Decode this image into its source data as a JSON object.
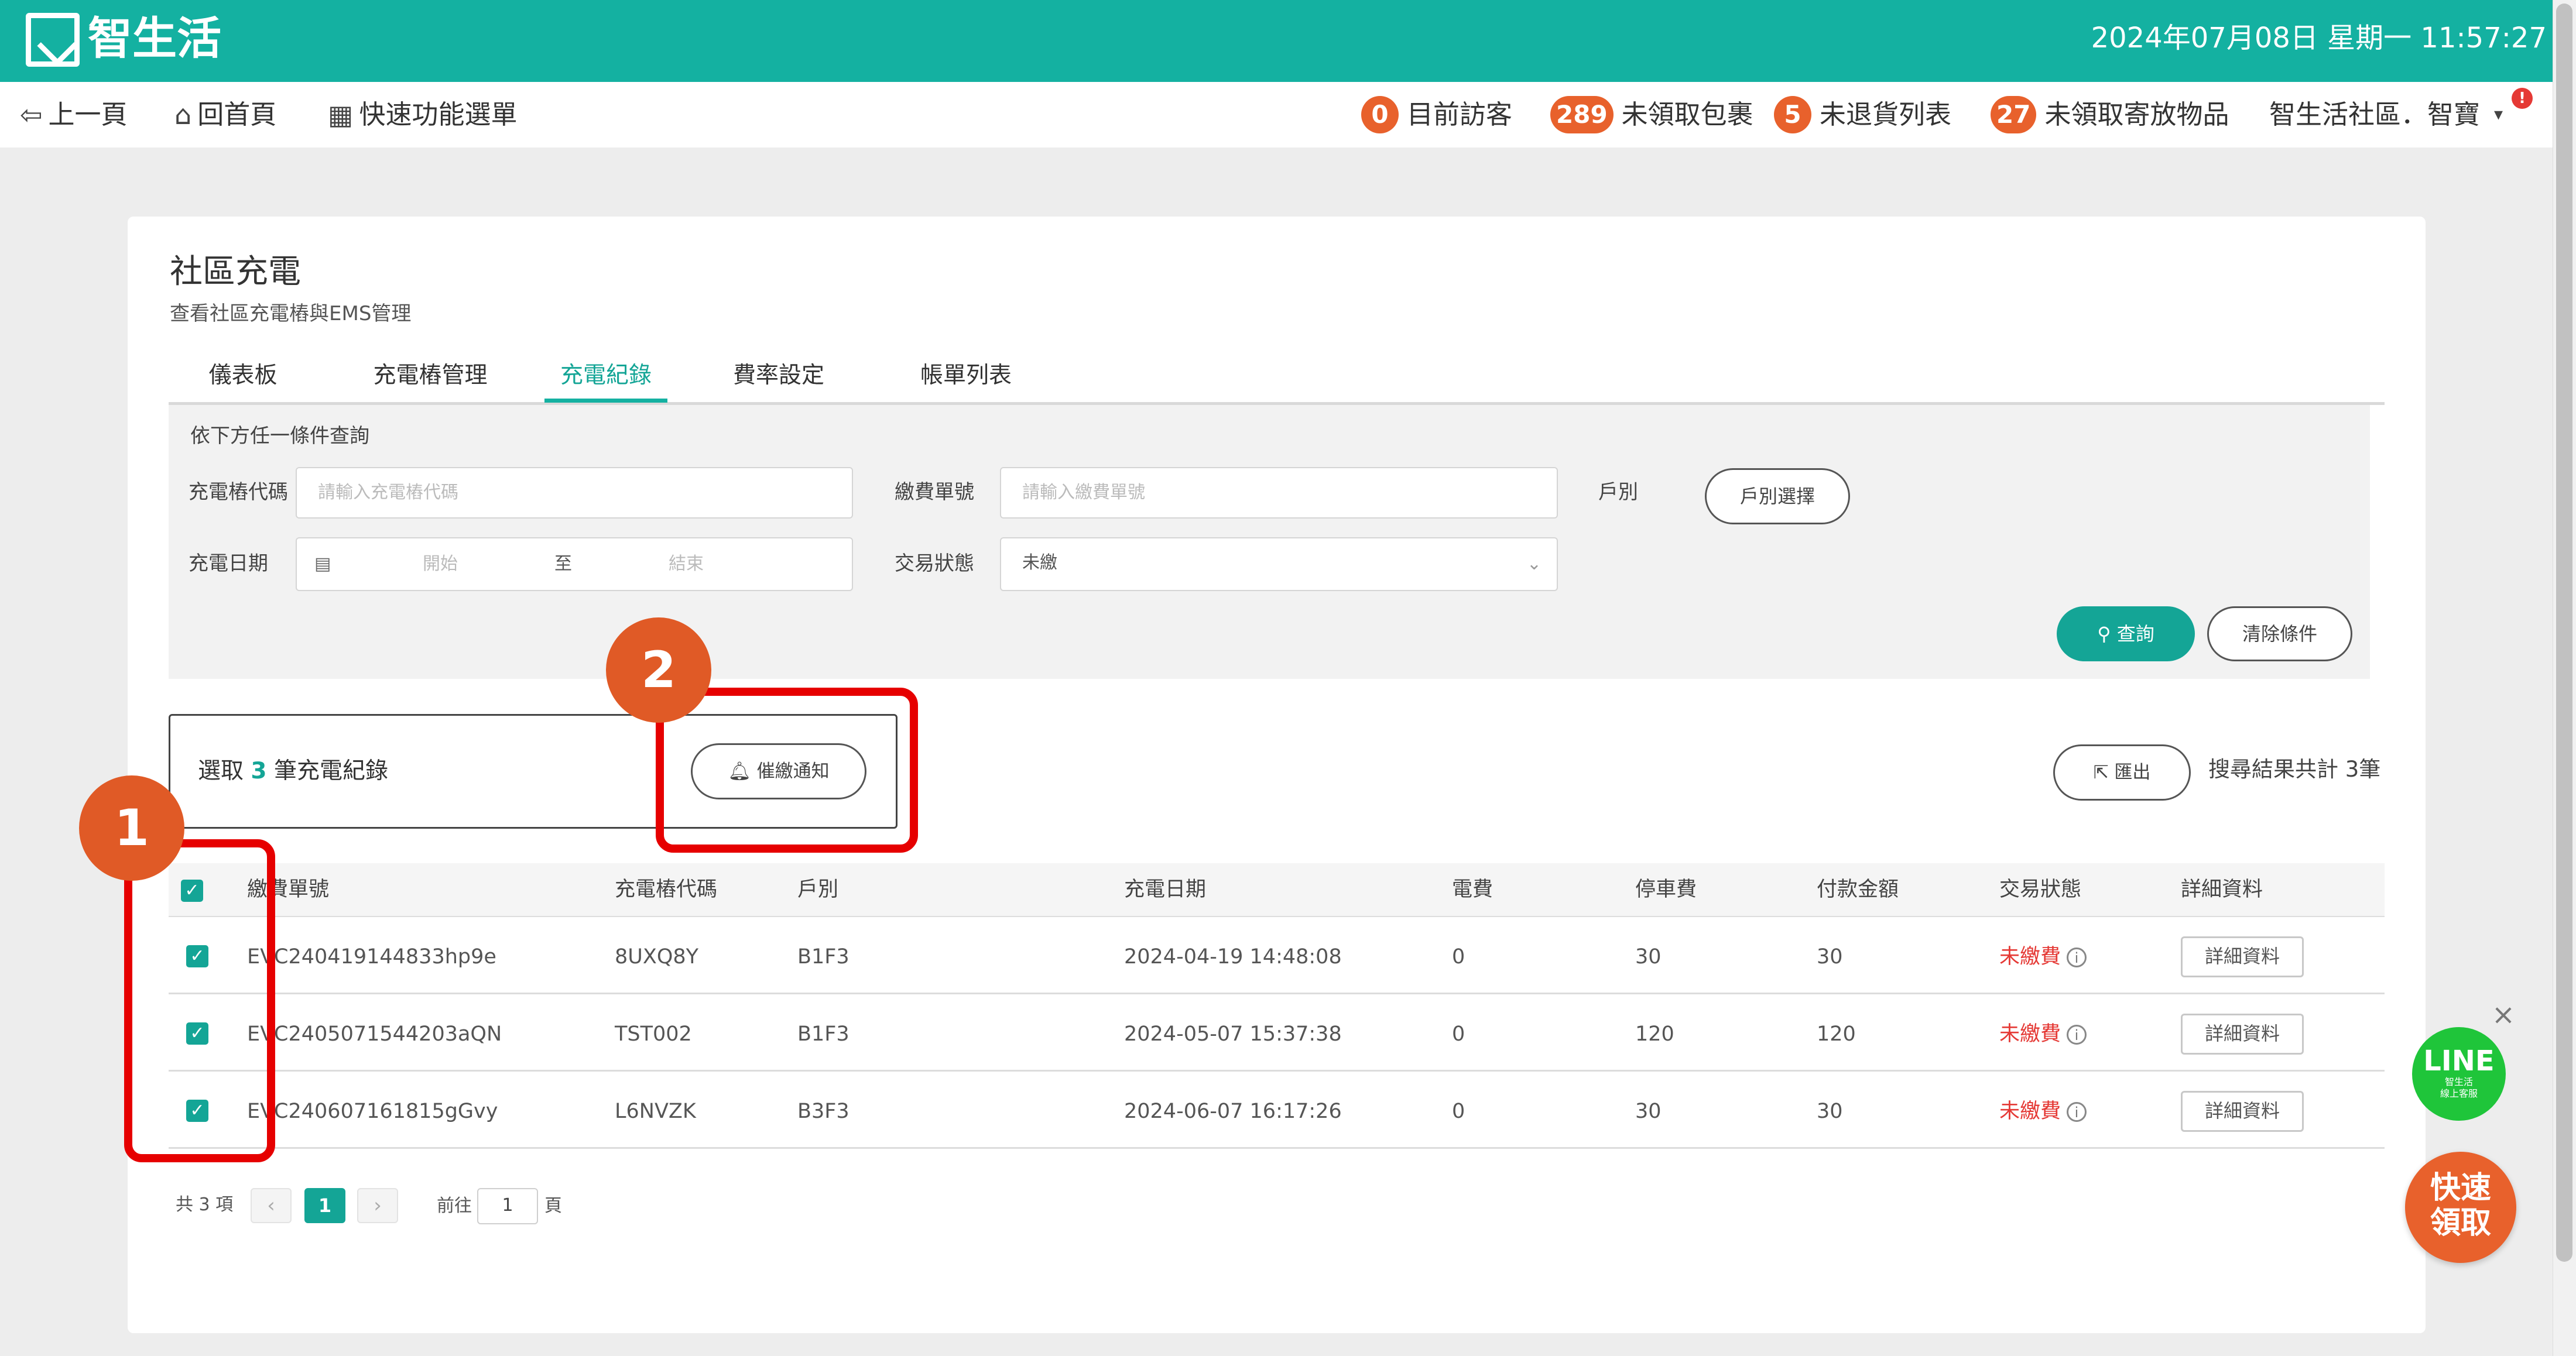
{
  "app": {
    "name": "智生活",
    "datetime": "2024年07月08日 星期一 11:57:27"
  },
  "nav": {
    "back": "上一頁",
    "home": "回首頁",
    "quick_menu": "快速功能選單",
    "visitors": {
      "count": "0",
      "label": "目前訪客"
    },
    "unclaimed_packages": {
      "count": "289",
      "label": "未領取包裹"
    },
    "unreturned": {
      "count": "5",
      "label": "未退貨列表"
    },
    "unclaimed_items": {
      "count": "27",
      "label": "未領取寄放物品"
    },
    "user": "智生活社區．智寶",
    "notif_badge": "!"
  },
  "page": {
    "title": "社區充電",
    "subtitle": "查看社區充電樁與EMS管理"
  },
  "tabs": [
    "儀表板",
    "充電樁管理",
    "充電紀錄",
    "費率設定",
    "帳單列表"
  ],
  "active_tab": "充電紀錄",
  "filter": {
    "hint": "依下方任一條件查詢",
    "pile_code_label": "充電樁代碼",
    "pile_code_placeholder": "請輸入充電樁代碼",
    "payment_no_label": "繳費單號",
    "payment_no_placeholder": "請輸入繳費單號",
    "household_label": "戶別",
    "household_button": "戶別選擇",
    "date_label": "充電日期",
    "date_start": "開始",
    "date_sep": "至",
    "date_end": "結束",
    "status_label": "交易狀態",
    "status_value": "未繳",
    "search_button": "查詢",
    "clear_button": "清除條件"
  },
  "selection": {
    "prefix": "選取",
    "count": "3",
    "suffix": "筆充電紀錄",
    "remind_button": "催繳通知"
  },
  "export_button": "匯出",
  "result_total": "搜尋結果共計 3筆",
  "table": {
    "headers": [
      "繳費單號",
      "充電樁代碼",
      "戶別",
      "充電日期",
      "電費",
      "停車費",
      "付款金額",
      "交易狀態",
      "詳細資料"
    ],
    "rows": [
      {
        "no": "EVC240419144833hp9e",
        "pile": "8UXQ8Y",
        "household": "B1F3",
        "date": "2024-04-19 14:48:08",
        "power_fee": "0",
        "parking_fee": "30",
        "amount": "30",
        "status": "未繳費",
        "detail": "詳細資料"
      },
      {
        "no": "EVC2405071544203aQN",
        "pile": "TST002",
        "household": "B1F3",
        "date": "2024-05-07 15:37:38",
        "power_fee": "0",
        "parking_fee": "120",
        "amount": "120",
        "status": "未繳費",
        "detail": "詳細資料"
      },
      {
        "no": "EVC240607161815gGvy",
        "pile": "L6NVZK",
        "household": "B3F3",
        "date": "2024-06-07 16:17:26",
        "power_fee": "0",
        "parking_fee": "30",
        "amount": "30",
        "status": "未繳費",
        "detail": "詳細資料"
      }
    ]
  },
  "pagination": {
    "total": "共 3 項",
    "current": "1",
    "goto_prefix": "前往",
    "goto_value": "1",
    "goto_suffix": "頁"
  },
  "annotations": {
    "step1": "1",
    "step2": "2"
  },
  "widgets": {
    "line_title": "LINE",
    "line_sub1": "智生活",
    "line_sub2": "線上客服",
    "quick_pickup": "快速領取"
  },
  "colors": {
    "brand": "#14b1a1",
    "accent": "#14a596",
    "badge": "#e8612c",
    "unpaid": "#e53935",
    "annotation": "#e60000"
  }
}
